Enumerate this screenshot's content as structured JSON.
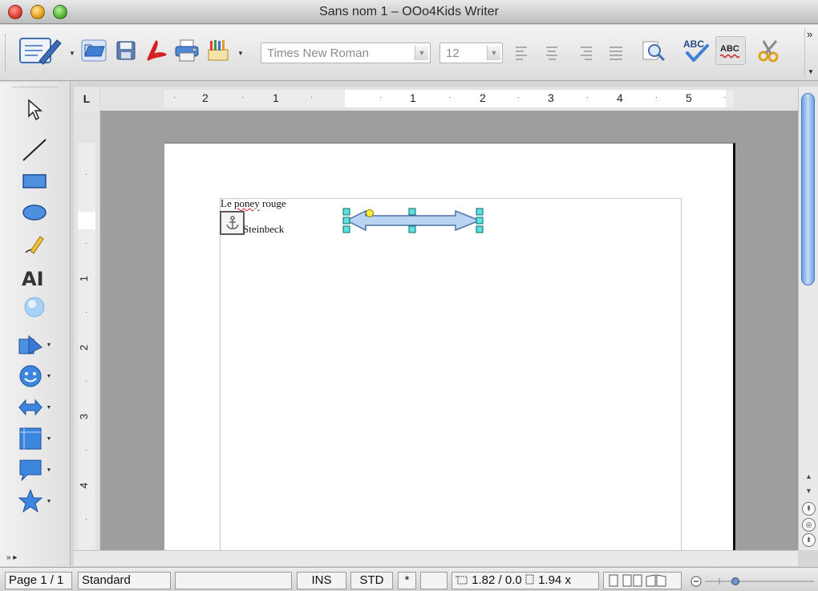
{
  "window": {
    "title": "Sans nom 1 – OOo4Kids Writer"
  },
  "toolbar": {
    "font_name": "Times New Roman",
    "font_size": "12",
    "buttons": [
      "edit-mode",
      "open",
      "save",
      "export-pdf",
      "print",
      "paint-tools",
      "zoom",
      "spellcheck",
      "auto-spellcheck",
      "cut"
    ],
    "overflow": "»"
  },
  "ruler": {
    "corner": "L",
    "h_labels": [
      "2",
      "1",
      "1",
      "2",
      "3",
      "4",
      "5"
    ],
    "v_labels": [
      "1",
      "2",
      "3",
      "4"
    ]
  },
  "document": {
    "line1_pre": "Le ",
    "line1_misspelled": "poney",
    "line1_post": " rouge",
    "line2": "Steinbeck",
    "shape": "left-right-arrow"
  },
  "left_tools": [
    "select",
    "line",
    "rectangle",
    "ellipse",
    "freeform",
    "fontwork",
    "extrusion",
    "basic-shapes",
    "symbol-shapes",
    "block-arrows",
    "flowchart",
    "callouts",
    "stars"
  ],
  "leftbar_footer": "» ▸",
  "statusbar": {
    "page": "Page 1 / 1",
    "style": "Standard",
    "language": "",
    "insert_mode": "INS",
    "selection_mode": "STD",
    "modified": "*",
    "signature": "",
    "position": "1.82 / 0.0",
    "size": "1.94 x"
  }
}
